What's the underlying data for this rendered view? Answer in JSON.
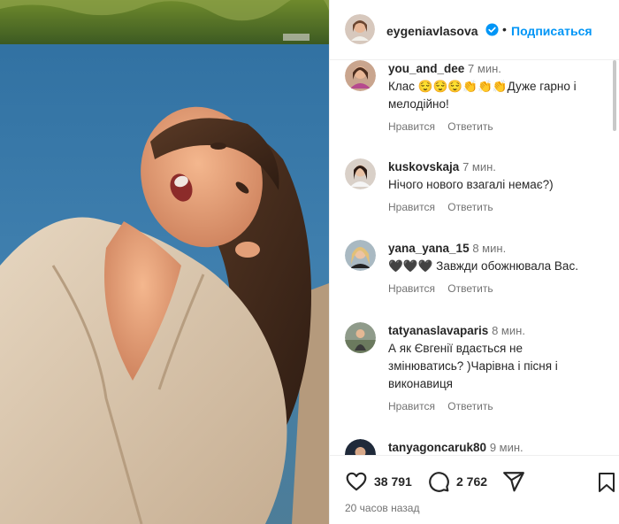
{
  "post": {
    "author": "eygeniavlasova",
    "separator": "•",
    "follow_label": "Подписаться",
    "verified_icon": "verified-badge-icon",
    "accent_color": "#0095f6"
  },
  "comments": [
    {
      "user": "you_and_dee",
      "time": "7 мин.",
      "text": "Клас 😌😌😌👏👏👏Дуже гарно і мелодійно!",
      "like_label": "Нравится",
      "reply_label": "Ответить"
    },
    {
      "user": "kuskovskaja",
      "time": "7 мин.",
      "text": "Нічого нового взагалі немає?)",
      "like_label": "Нравится",
      "reply_label": "Ответить"
    },
    {
      "user": "yana_yana_15",
      "time": "8 мин.",
      "text": "🖤🖤🖤 Завжди обожнювала Вас.",
      "like_label": "Нравится",
      "reply_label": "Ответить"
    },
    {
      "user": "tatyanaslavaparis",
      "time": "8 мин.",
      "text": "А як Євгенії вдається не змінюватись? )Чарівна і пісня і виконавиця",
      "like_label": "Нравится",
      "reply_label": "Ответить"
    },
    {
      "user": "tanyagoncaruk80",
      "time": "9 мин.",
      "text": "",
      "like_label": "",
      "reply_label": ""
    }
  ],
  "footer": {
    "likes": "38 791",
    "comments_count": "2 762",
    "posted_ago": "20 часов назад"
  }
}
